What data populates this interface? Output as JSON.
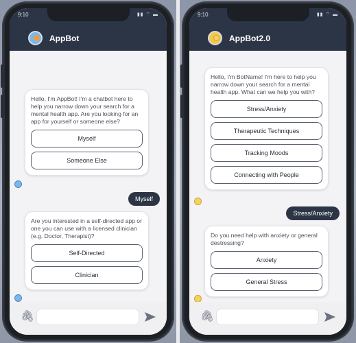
{
  "screens": [
    {
      "status": {
        "time": "9:10",
        "icons": "▮▮ ⌔ ▬"
      },
      "header": {
        "title": "AppBot",
        "avatar_icon": "appbot-avatar-icon"
      },
      "messages": {
        "bot1": {
          "text": "Hello, I'm AppBot! I'm a chatbot here to help you narrow down your search for a mental health app. Are you looking for an app for yourself or someone else?",
          "options": [
            "Myself",
            "Someone Else"
          ]
        },
        "user1": "Myself",
        "bot2": {
          "text": "Are you interested in a self-directed app or one you can use with a licensed clinician (e.g. Doctor, Therapist)?",
          "options": [
            "Self-Directed",
            "Clinician"
          ]
        }
      }
    },
    {
      "status": {
        "time": "9:10",
        "icons": "▮▮ ⌔ ▬"
      },
      "header": {
        "title": "AppBot2.0",
        "avatar_icon": "appbot2-avatar-icon"
      },
      "messages": {
        "bot1": {
          "text": "Hello, I'm BotName! I'm here to help you narrow down your search for a mental health app. What can we help you with?",
          "options": [
            "Stress/Anxiety",
            "Therapeutic Techniques",
            "Tracking Moods",
            "Connecting with People"
          ]
        },
        "user1": "Stress/Anxiety",
        "bot2": {
          "text": "Do you need help with anxiety or general destressing?",
          "options": [
            "Anxiety",
            "General Stress"
          ]
        }
      }
    }
  ],
  "colors": {
    "header": "#2c3546",
    "accent_user_bubble": "#2c3546",
    "chat_bg": "#f3f3f5"
  }
}
